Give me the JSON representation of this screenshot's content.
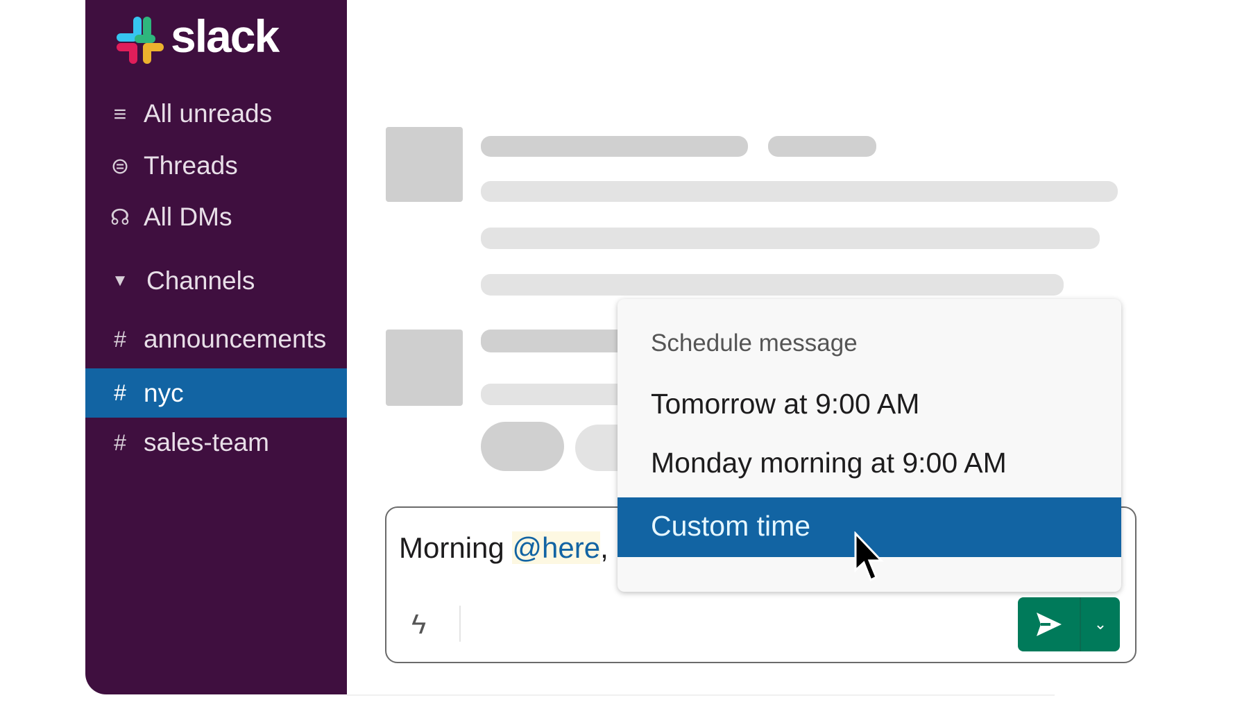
{
  "app": {
    "logo": "slack",
    "colors": {
      "sidebar": "#3f0f3f",
      "selected": "#1264a3",
      "send": "#007a5a"
    }
  },
  "sidebar": {
    "nav": [
      {
        "label": "All unreads",
        "icon": "list-icon"
      },
      {
        "label": "Threads",
        "icon": "threads-icon"
      },
      {
        "label": "All DMs",
        "icon": "dms-icon"
      }
    ],
    "channels_header": "Channels",
    "channels": [
      {
        "label": "announcements",
        "selected": false
      },
      {
        "label": "nyc",
        "selected": true
      },
      {
        "label": "sales-team",
        "selected": false
      }
    ],
    "hash": "#"
  },
  "composer": {
    "text": "Morning ",
    "mention": "@here",
    "rest": ", c"
  },
  "menu": {
    "title": "Schedule message",
    "items": [
      "Tomorrow at 9:00 AM",
      "Monday morning at 9:00 AM",
      "Custom time"
    ],
    "highlighted": "Custom time"
  }
}
